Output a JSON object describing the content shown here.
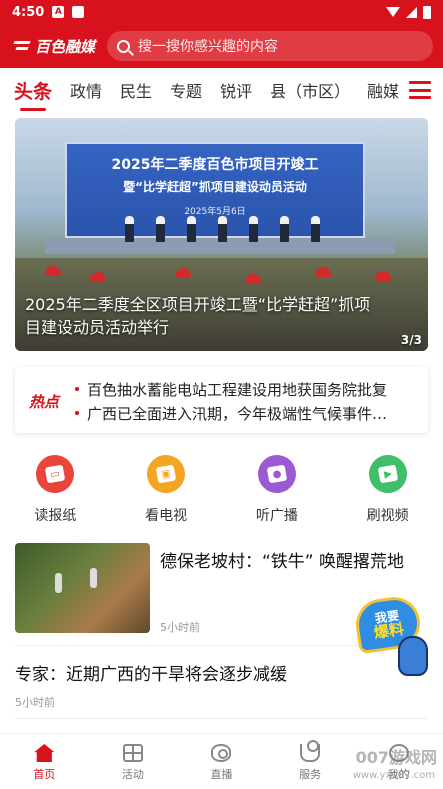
{
  "status_bar": {
    "time": "4:50",
    "notification_badge": "A"
  },
  "header": {
    "app_name": "百色融媒",
    "search_placeholder": "搜一搜你感兴趣的内容"
  },
  "tabs": {
    "items": [
      "头条",
      "政情",
      "民生",
      "专题",
      "锐评",
      "县（市区）"
    ],
    "overflow_label": "融媒",
    "active_index": 0
  },
  "hero": {
    "board_title_line1": "2025年二季度百色市项目开竣工",
    "board_title_line2": "暨“比学赶超”抓项目建设动员活动",
    "board_date": "2025年5月6日",
    "caption": "2025年二季度全区项目开竣工暨“比学赶超”抓项目建设动员活动举行",
    "pager": "3/3"
  },
  "hot_news": {
    "label": "热点",
    "items": [
      "百色抽水蓄能电站工程建设用地获国务院批复",
      "广西已全面进入汛期，今年极端性气候事件…"
    ]
  },
  "quick_actions": [
    {
      "label": "读报纸",
      "icon": "newspaper-icon",
      "color": "#e8463a"
    },
    {
      "label": "看电视",
      "icon": "tv-icon",
      "color": "#f4a623"
    },
    {
      "label": "听广播",
      "icon": "radio-icon",
      "color": "#9b59d6"
    },
    {
      "label": "刷视频",
      "icon": "video-icon",
      "color": "#3fbf6a"
    }
  ],
  "news": [
    {
      "title": "德保老坡村：“铁牛” 唤醒撂荒地",
      "time": "5小时前"
    },
    {
      "title": "专家：近期广西的干旱将会逐步减缓",
      "time": "5小时前"
    }
  ],
  "report_button": {
    "line1": "我要",
    "line2": "爆料"
  },
  "bottom_nav": [
    {
      "label": "首页",
      "icon": "home-icon"
    },
    {
      "label": "活动",
      "icon": "activity-icon"
    },
    {
      "label": "直播",
      "icon": "live-icon"
    },
    {
      "label": "服务",
      "icon": "service-icon"
    },
    {
      "label": "我的",
      "icon": "mine-icon"
    }
  ],
  "watermark": {
    "text": "007游戏网",
    "url": "www.yx007.com"
  },
  "colors": {
    "brand_red": "#d8121c"
  }
}
